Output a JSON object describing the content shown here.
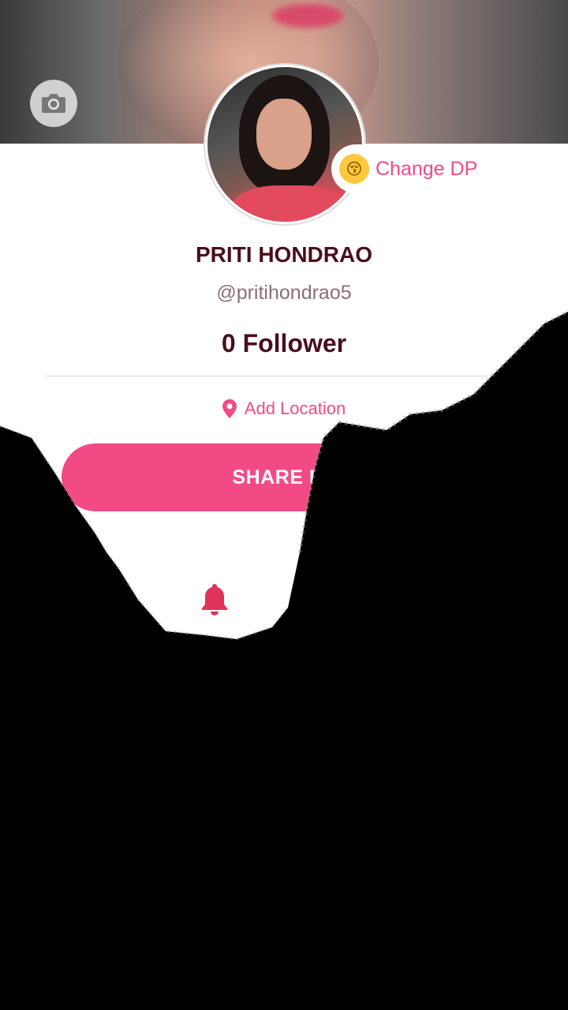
{
  "profile": {
    "name": "PRITI HONDRAO",
    "handle": "@pritihondrao5",
    "followers": "0 Follower",
    "change_dp_label": "Change DP",
    "add_location_label": "Add Location",
    "share_button_label": "SHARE PR"
  },
  "icons": {
    "camera": "camera-icon",
    "emoji": "kissing-face-icon",
    "location": "location-pin-icon",
    "bell": "bell-icon"
  },
  "colors": {
    "accent": "#f24a85",
    "name_text": "#4a0e1c",
    "handle_text": "#8a7076"
  }
}
